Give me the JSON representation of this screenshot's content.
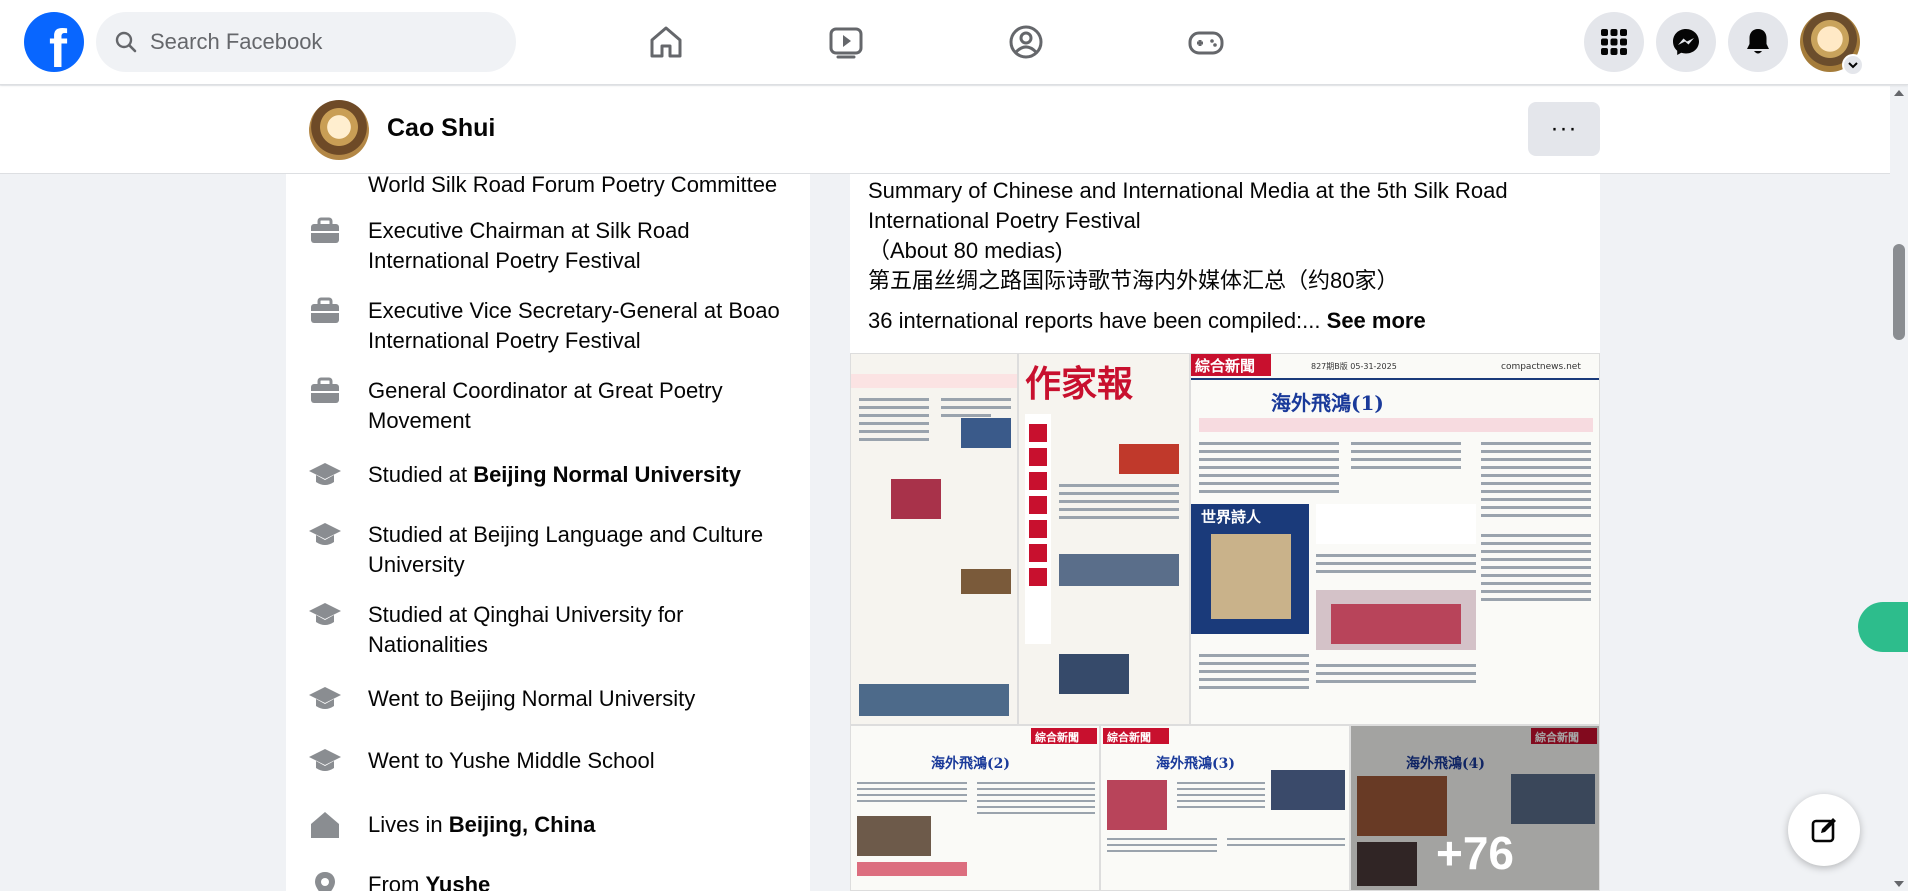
{
  "nav": {
    "search_placeholder": "Search Facebook",
    "icons": [
      "home-icon",
      "watch-icon",
      "groups-icon",
      "gaming-icon"
    ],
    "right_icons": [
      "menu-grid-icon",
      "messenger-icon",
      "notifications-icon"
    ],
    "brand_color": "#0866ff"
  },
  "profile": {
    "name": "Cao Shui",
    "more_label": "···"
  },
  "intro": {
    "items": [
      {
        "text": "World Silk Road Forum Poetry Committee",
        "bold": ""
      },
      {
        "text": "Executive Chairman at Silk Road International Poetry Festival",
        "bold": ""
      },
      {
        "text": "Executive Vice Secretary-General at Boao International Poetry Festival",
        "bold": ""
      },
      {
        "text": "General Coordinator at Great Poetry Movement",
        "bold": ""
      },
      {
        "text": "Studied at ",
        "bold": "Beijing Normal University"
      },
      {
        "text": "Studied at Beijing Language and Culture University",
        "bold": ""
      },
      {
        "text": "Studied at Qinghai University for Nationalities",
        "bold": ""
      },
      {
        "text": "Went to Beijing Normal University",
        "bold": ""
      },
      {
        "text": "Went to Yushe Middle School",
        "bold": ""
      },
      {
        "text": "Lives in ",
        "bold": "Beijing, China"
      },
      {
        "text": "From ",
        "bold": "Yushe"
      }
    ]
  },
  "post": {
    "line1": "Summary of Chinese and International Media at the 5th Silk Road International Poetry Festival",
    "line2": "（About 80 medias)",
    "line3": "第五届丝绸之路国际诗歌节海内外媒体汇总（约80家）",
    "line4": "36 international reports have been compiled:...",
    "see_more": "See more",
    "photo_overflow": "+76",
    "newspaper": {
      "masthead1": "作家報",
      "section": "綜合新聞",
      "headline1": "海外飛鴻(1)",
      "headline2": "海外飛鴻(2)",
      "headline3": "海外飛鴻(3)",
      "headline4": "海外飛鴻(4)",
      "site": "compactnews.net",
      "date": "827期B版 05-31-2025",
      "magazine": "世界詩人"
    }
  }
}
